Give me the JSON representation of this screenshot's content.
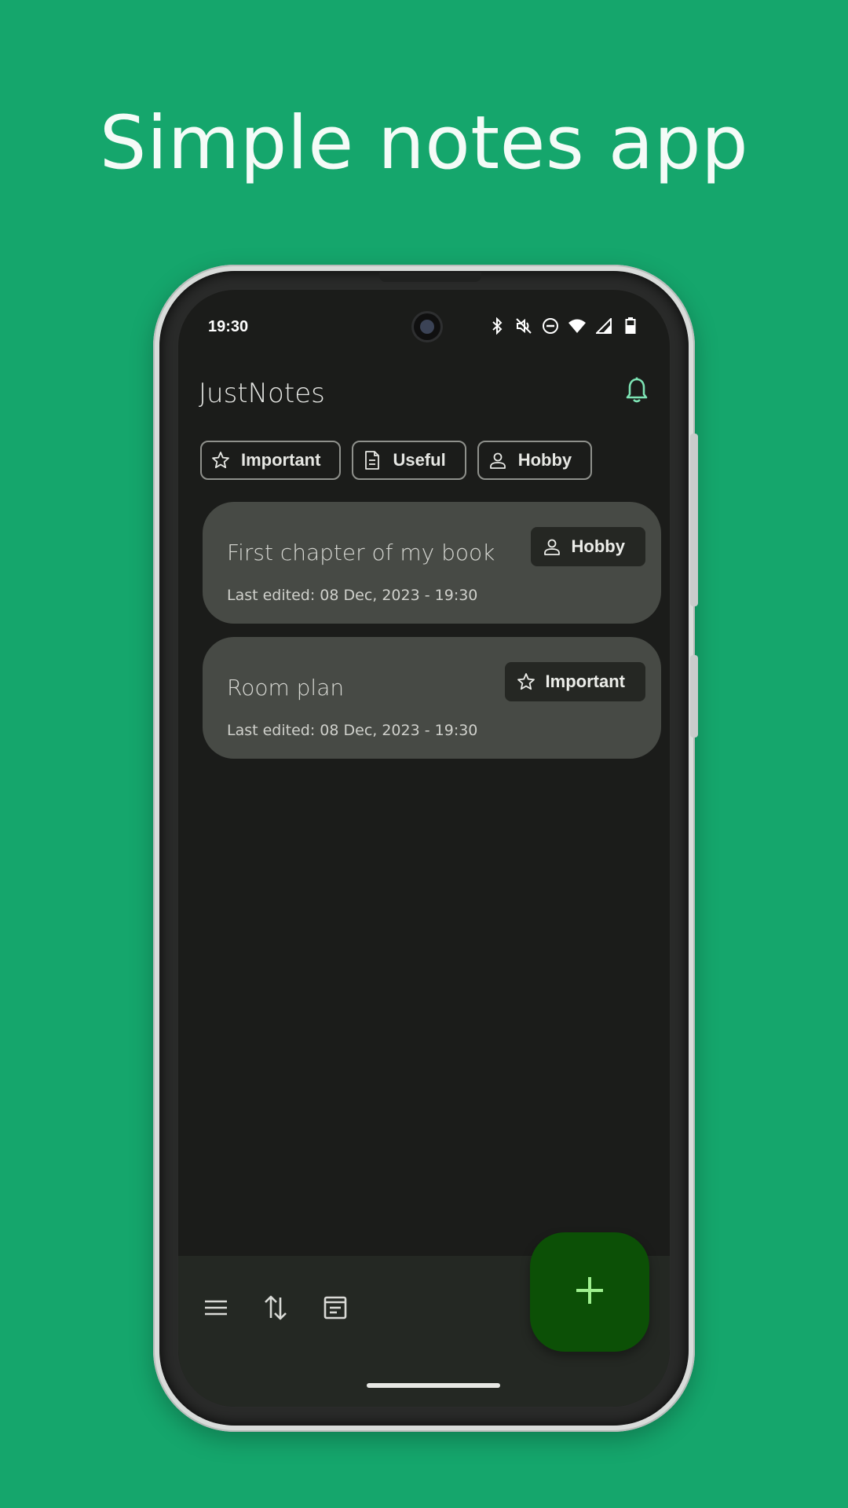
{
  "headline": "Simple notes app",
  "status_bar": {
    "time": "19:30",
    "icons": [
      "bluetooth-icon",
      "volume-off-icon",
      "do-not-disturb-icon",
      "wifi-icon",
      "signal-icon",
      "battery-icon"
    ]
  },
  "app_bar": {
    "title": "JustNotes",
    "action_icon": "bell-icon"
  },
  "filter_chips": [
    {
      "label": "Important",
      "icon": "star-icon"
    },
    {
      "label": "Useful",
      "icon": "document-icon"
    },
    {
      "label": "Hobby",
      "icon": "person-icon"
    }
  ],
  "notes": [
    {
      "title": "First chapter of my book",
      "date": "Last edited: 08 Dec, 2023 - 19:30",
      "tag": "Hobby",
      "tag_icon": "person-icon"
    },
    {
      "title": "Room plan",
      "date": "Last edited: 08 Dec, 2023 - 19:30",
      "tag": "Important",
      "tag_icon": "star-icon"
    }
  ],
  "bottom_bar": {
    "icons": [
      "menu-icon",
      "sort-icon",
      "notes-view-icon"
    ]
  },
  "fab_icon": "plus-icon",
  "colors": {
    "background": "#15a66c",
    "accent": "#7de3b4",
    "fab": "#0c5006",
    "fab_icon": "#9ef08e",
    "card": "#474a45",
    "screen": "#1b1c1a"
  }
}
